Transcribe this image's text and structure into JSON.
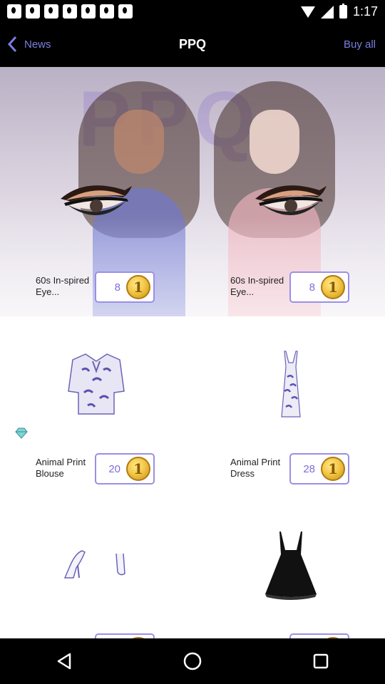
{
  "status_bar": {
    "time": "1:17"
  },
  "nav": {
    "back_label": "News",
    "title": "PPQ",
    "buy_all_label": "Buy all"
  },
  "hero": {
    "background_text": "PPQ"
  },
  "items": [
    {
      "name": "60s In-spired Eye...",
      "price": "8",
      "icon": "eye-makeup-icon"
    },
    {
      "name": "60s In-spired Eye...",
      "price": "8",
      "icon": "eye-makeup-icon"
    },
    {
      "name": "Animal Print Blouse",
      "price": "20",
      "icon": "blouse-icon"
    },
    {
      "name": "Animal Print Dress",
      "price": "28",
      "icon": "dress-icon"
    },
    {
      "name": "",
      "price": "",
      "icon": "heels-icon"
    },
    {
      "name": "",
      "price": "",
      "icon": "black-dress-icon"
    }
  ],
  "coin_label": "1",
  "colors": {
    "accent": "#7b7fe0",
    "price_border": "#9b8fe6",
    "coin": "#f3c84a"
  }
}
